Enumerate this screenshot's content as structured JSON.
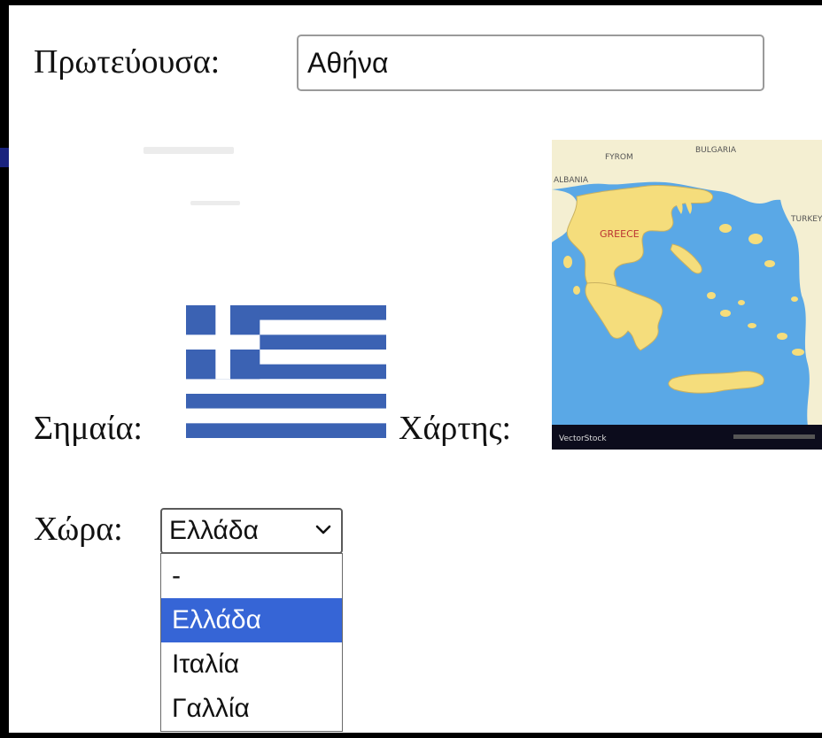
{
  "capital": {
    "label": "Πρωτεύουσα:",
    "value": "Αθήνα"
  },
  "flag": {
    "label": "Σημαία:",
    "colors": {
      "blue": "#3b62b3",
      "white": "#ffffff"
    }
  },
  "map": {
    "label": "Χάρτης:",
    "place_labels": {
      "fyrom": "FYROM",
      "bulgaria": "BULGARIA",
      "albania": "ALBANIA",
      "turkey": "TURKEY",
      "greece": "GREECE"
    },
    "watermark": "VectorStock"
  },
  "country": {
    "label": "Χώρα:",
    "selected": "Ελλάδα",
    "options": [
      "-",
      "Ελλάδα",
      "Ιταλία",
      "Γαλλία"
    ],
    "highlight_color": "#3665d6"
  }
}
